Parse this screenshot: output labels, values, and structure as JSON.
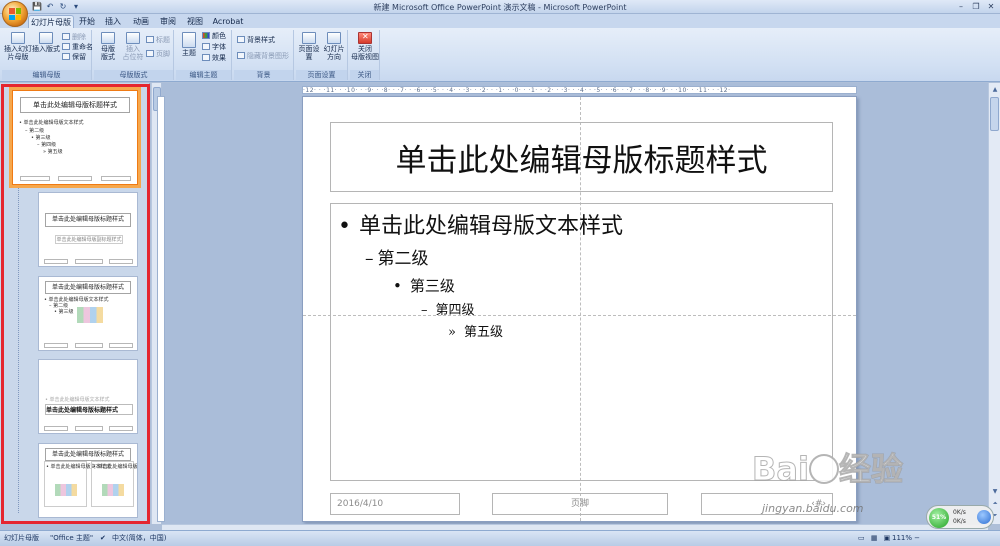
{
  "window": {
    "title": "新建 Microsoft Office PowerPoint 演示文稿 - Microsoft PowerPoint",
    "qat": [
      "💾",
      "↶",
      "↻",
      "▾"
    ],
    "controls": [
      "–",
      "❐",
      "✕"
    ]
  },
  "tabs": [
    "幻灯片母版",
    "开始",
    "插入",
    "动画",
    "审阅",
    "视图",
    "Acrobat"
  ],
  "ribbon": {
    "groups": {
      "edit_master": "编辑母版",
      "master_layout": "母版版式",
      "edit_theme": "编辑主题",
      "background": "背景",
      "page_setup": "页面设置",
      "close": "关闭"
    },
    "insert_slide_master": [
      "插入幻灯",
      "片母版"
    ],
    "insert_layout": [
      "插入版式"
    ],
    "delete": "删除",
    "rename": "重命名",
    "preserve": "保留",
    "master_layout_btn": [
      "母版",
      "版式"
    ],
    "insert_placeholder": [
      "插入",
      "占位符"
    ],
    "title_check": "标题",
    "footer_check": "页脚",
    "themes": "主题",
    "colors": "颜色",
    "fonts": "字体",
    "effects": "效果",
    "background_styles": "背景样式",
    "hide_background": "隐藏背景图形",
    "page_setup_btn": "页面设置",
    "slide_orientation": [
      "幻灯片",
      "方向"
    ],
    "close_master": [
      "关闭",
      "母版视图"
    ]
  },
  "slide": {
    "title": "单击此处编辑母版标题样式",
    "levels": [
      {
        "bullet": "•",
        "text": "单击此处编辑母版文本样式"
      },
      {
        "bullet": "–",
        "text": "第二级"
      },
      {
        "bullet": "•",
        "text": "第三级"
      },
      {
        "bullet": "–",
        "text": "第四级"
      },
      {
        "bullet": "»",
        "text": "第五级"
      }
    ],
    "date": "2016/4/10",
    "footer": "页脚",
    "number": "‹#›",
    "ruler": "·12·  ·  ·11·  ·  ·10·  ·  ·9·  ·  ·8·  ·  ·7·  ·  ·6·  ·  ·5·  ·  ·4·  ·  ·3·  ·  ·2·  ·  ·1·  ·  ·0·  ·  ·1·  ·  ·2·  ·  ·3·  ·  ·4·  ·  ·5·  ·  ·6·  ·  ·7·  ·  ·8·  ·  ·9·  ·  ·10·  ·  ·11·  ·  ·12·"
  },
  "thumbnails": {
    "master_title": "单击此处编辑母版标题样式",
    "master_lines": [
      "• 单击此处编辑母版文本样式",
      "– 第二级",
      "• 第三级",
      "– 第四级",
      "» 第五级"
    ],
    "layout_title": "单击此处编辑母版标题样式",
    "layout_subtitle": "单击此处编辑母版副标题样式",
    "section_title": "单击此处编辑母版标题样式"
  },
  "statusbar": {
    "view": "幻灯片母版",
    "theme": "\"Office 主题\"",
    "language": "中文(简体，中国)",
    "zoom": "111%"
  },
  "watermark": {
    "logo": "Bai",
    "logo2": "经验",
    "url": "jingyan.baidu.com"
  },
  "netwidget": {
    "label": "51%",
    "up": "0K/s",
    "down": "0K/s"
  }
}
